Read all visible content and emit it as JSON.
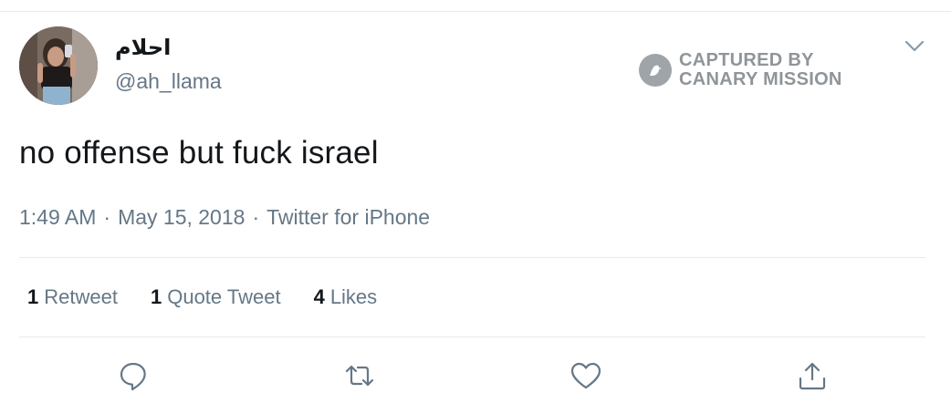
{
  "tweet": {
    "display_name": "احلام",
    "handle": "@ah_llama",
    "text": "no offense but fuck israel",
    "time": "1:49 AM",
    "date": "May 15, 2018",
    "source": "Twitter for iPhone",
    "separator": "·"
  },
  "stats": {
    "retweets_count": "1",
    "retweets_label": "Retweet",
    "quote_count": "1",
    "quote_label": "Quote Tweet",
    "likes_count": "4",
    "likes_label": "Likes"
  },
  "watermark": {
    "line1": "CAPTURED BY",
    "line2": "CANARY MISSION",
    "icon": "canary-bird-icon"
  },
  "icons": {
    "menu": "chevron-down-icon",
    "reply": "reply-icon",
    "retweet": "retweet-icon",
    "like": "heart-icon",
    "share": "share-icon"
  },
  "colors": {
    "text": "#14171a",
    "secondary": "#657786",
    "divider": "#e6ecf0",
    "watermark": "#8f9599"
  }
}
